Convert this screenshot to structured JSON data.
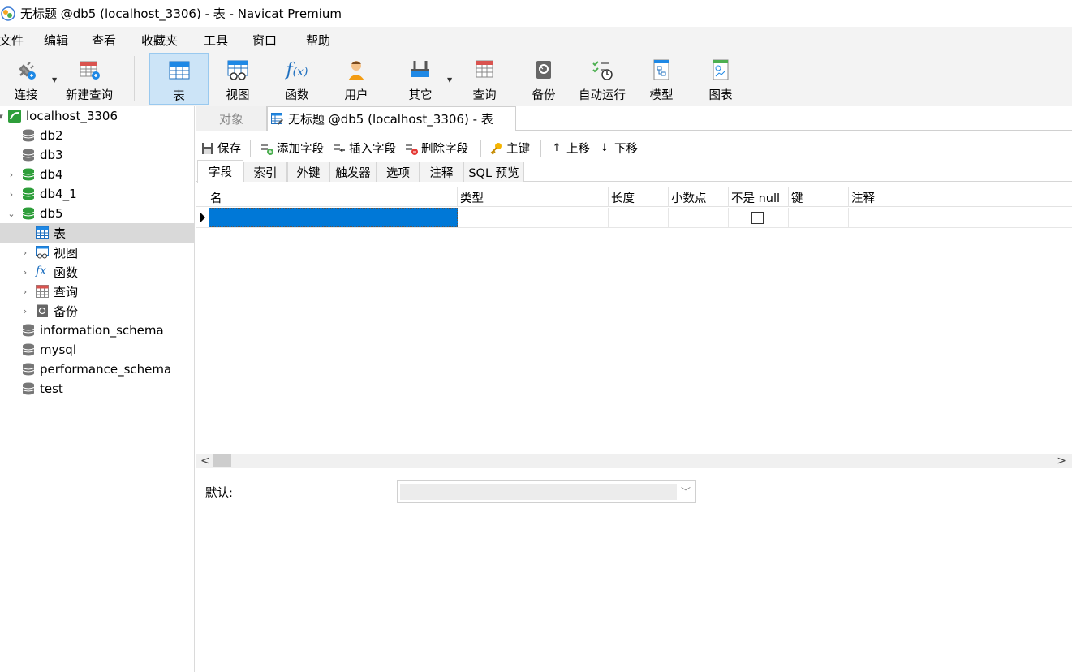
{
  "window": {
    "title": "无标题 @db5 (localhost_3306) - 表 - Navicat Premium"
  },
  "menu": [
    "文件",
    "编辑",
    "查看",
    "收藏夹",
    "工具",
    "窗口",
    "帮助"
  ],
  "toolbar": {
    "buttons": [
      {
        "label": "连接",
        "icon": "plug-icon"
      },
      {
        "label": "新建查询",
        "icon": "new-query-icon"
      },
      {
        "label": "表",
        "icon": "table-icon",
        "active": true
      },
      {
        "label": "视图",
        "icon": "view-icon"
      },
      {
        "label": "函数",
        "icon": "function-icon"
      },
      {
        "label": "用户",
        "icon": "user-icon"
      },
      {
        "label": "其它",
        "icon": "tools-icon"
      },
      {
        "label": "查询",
        "icon": "query-icon"
      },
      {
        "label": "备份",
        "icon": "backup-icon"
      },
      {
        "label": "自动运行",
        "icon": "schedule-icon"
      },
      {
        "label": "模型",
        "icon": "model-icon"
      },
      {
        "label": "图表",
        "icon": "chart-icon"
      }
    ]
  },
  "sidebar": {
    "connection": "localhost_3306",
    "items": [
      {
        "label": "db2"
      },
      {
        "label": "db3"
      },
      {
        "label": "db4"
      },
      {
        "label": "db4_1"
      },
      {
        "label": "db5"
      },
      {
        "label": "表"
      },
      {
        "label": "视图"
      },
      {
        "label": "函数"
      },
      {
        "label": "查询"
      },
      {
        "label": "备份"
      },
      {
        "label": "information_schema"
      },
      {
        "label": "mysql"
      },
      {
        "label": "performance_schema"
      },
      {
        "label": "test"
      }
    ]
  },
  "tabs": {
    "objects": "对象",
    "document": "无标题 @db5 (localhost_3306) - 表"
  },
  "actions": {
    "save": "保存",
    "add_field": "添加字段",
    "insert_field": "插入字段",
    "delete_field": "删除字段",
    "primary_key": "主键",
    "move_up": "上移",
    "move_down": "下移"
  },
  "subtabs": [
    "字段",
    "索引",
    "外键",
    "触发器",
    "选项",
    "注释",
    "SQL 预览"
  ],
  "grid": {
    "columns": [
      "名",
      "类型",
      "长度",
      "小数点",
      "不是 null",
      "键",
      "注释"
    ]
  },
  "properties": {
    "default_label": "默认:"
  },
  "colors": {
    "selection": "#0078d7",
    "active_toolbar": "#cce4f7",
    "db_open": "#2e9e3a"
  }
}
